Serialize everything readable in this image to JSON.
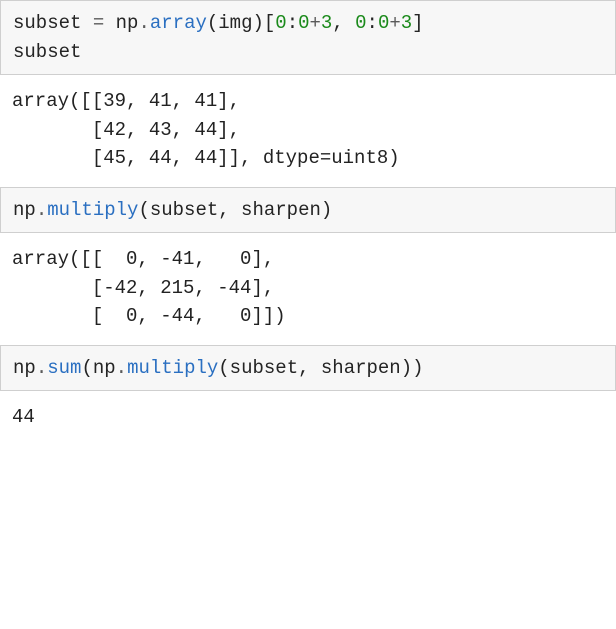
{
  "cells": [
    {
      "type": "input",
      "tokens": [
        {
          "t": "subset ",
          "cls": "c-default"
        },
        {
          "t": "=",
          "cls": "c-op"
        },
        {
          "t": " np",
          "cls": "c-default"
        },
        {
          "t": ".",
          "cls": "c-op"
        },
        {
          "t": "array",
          "cls": "c-method"
        },
        {
          "t": "(img)[",
          "cls": "c-default"
        },
        {
          "t": "0",
          "cls": "c-num"
        },
        {
          "t": ":",
          "cls": "c-default"
        },
        {
          "t": "0",
          "cls": "c-num"
        },
        {
          "t": "+",
          "cls": "c-op"
        },
        {
          "t": "3",
          "cls": "c-num"
        },
        {
          "t": ", ",
          "cls": "c-default"
        },
        {
          "t": "0",
          "cls": "c-num"
        },
        {
          "t": ":",
          "cls": "c-default"
        },
        {
          "t": "0",
          "cls": "c-num"
        },
        {
          "t": "+",
          "cls": "c-op"
        },
        {
          "t": "3",
          "cls": "c-num"
        },
        {
          "t": "]\nsubset",
          "cls": "c-default"
        }
      ]
    },
    {
      "type": "output",
      "text": "array([[39, 41, 41],\n       [42, 43, 44],\n       [45, 44, 44]], dtype=uint8)"
    },
    {
      "type": "input",
      "tokens": [
        {
          "t": "np",
          "cls": "c-default"
        },
        {
          "t": ".",
          "cls": "c-op"
        },
        {
          "t": "multiply",
          "cls": "c-method"
        },
        {
          "t": "(subset, sharpen)",
          "cls": "c-default"
        }
      ]
    },
    {
      "type": "output",
      "text": "array([[  0, -41,   0],\n       [-42, 215, -44],\n       [  0, -44,   0]])"
    },
    {
      "type": "input",
      "tokens": [
        {
          "t": "np",
          "cls": "c-default"
        },
        {
          "t": ".",
          "cls": "c-op"
        },
        {
          "t": "sum",
          "cls": "c-method"
        },
        {
          "t": "(np",
          "cls": "c-default"
        },
        {
          "t": ".",
          "cls": "c-op"
        },
        {
          "t": "multiply",
          "cls": "c-method"
        },
        {
          "t": "(subset, sharpen))",
          "cls": "c-default"
        }
      ]
    },
    {
      "type": "output",
      "text": "44"
    }
  ]
}
